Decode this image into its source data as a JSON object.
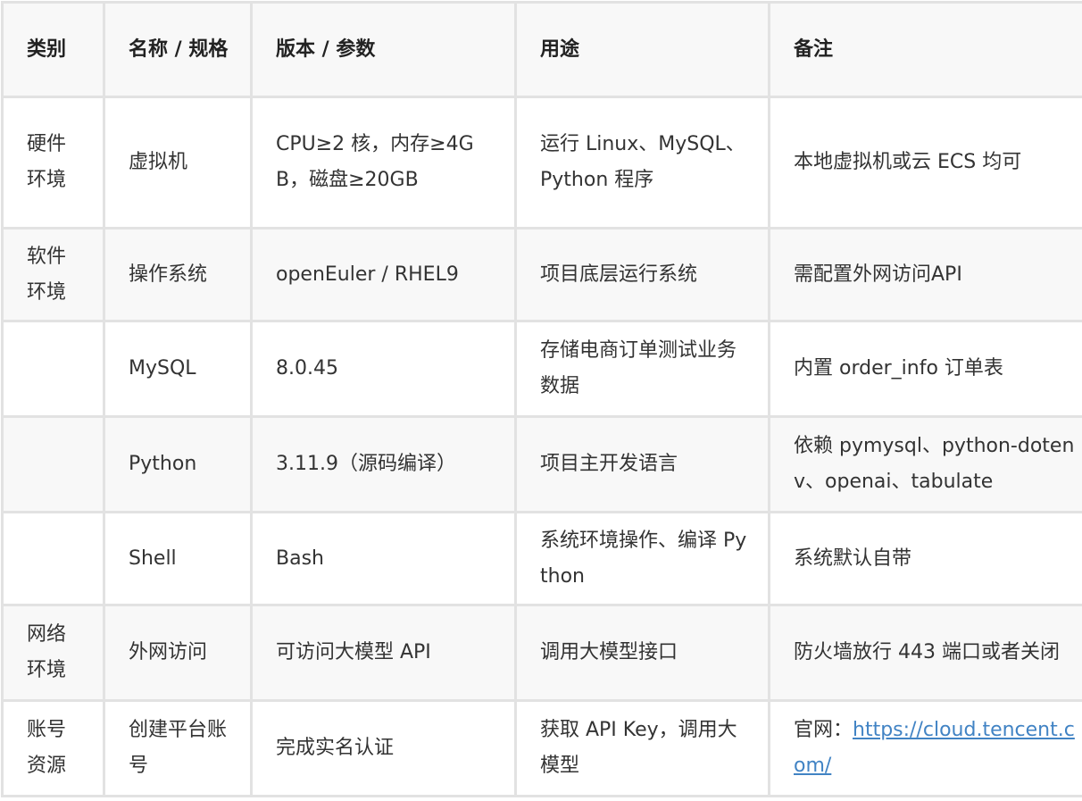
{
  "headers": {
    "category": "类别",
    "name": "名称 / 规格",
    "version": "版本 / 参数",
    "usage": "用途",
    "notes": "备注"
  },
  "rows": [
    {
      "category": "硬件环境",
      "name": "虚拟机",
      "version": "CPU≥2 核，内存≥4GB，磁盘≥20GB",
      "usage": "运行 Linux、MySQL、Python 程序",
      "notes": "本地虚拟机或云 ECS 均可"
    },
    {
      "category": "软件环境",
      "name": "操作系统",
      "version": "openEuler / RHEL9",
      "usage": "项目底层运行系统",
      "notes": "需配置外网访问API"
    },
    {
      "category": "",
      "name": "MySQL",
      "version": "8.0.45",
      "usage": "存储电商订单测试业务数据",
      "notes": "内置 order_info 订单表"
    },
    {
      "category": "",
      "name": "Python",
      "version": "3.11.9（源码编译）",
      "usage": "项目主开发语言",
      "notes": "依赖 pymysql、python-dotenv、openai、tabulate"
    },
    {
      "category": "",
      "name": "Shell",
      "version": "Bash",
      "usage": "系统环境操作、编译 Python",
      "notes": "系统默认自带"
    },
    {
      "category": "网络环境",
      "name": "外网访问",
      "version": "可访问大模型 API",
      "usage": "调用大模型接口",
      "notes": "防火墙放行 443 端口或者关闭"
    },
    {
      "category": "账号资源",
      "name": "创建平台账号",
      "version": "完成实名认证",
      "usage": "获取 API Key，调用大模型",
      "notes_prefix": "官网：",
      "notes_link": "https://cloud.tencent.com/"
    }
  ]
}
